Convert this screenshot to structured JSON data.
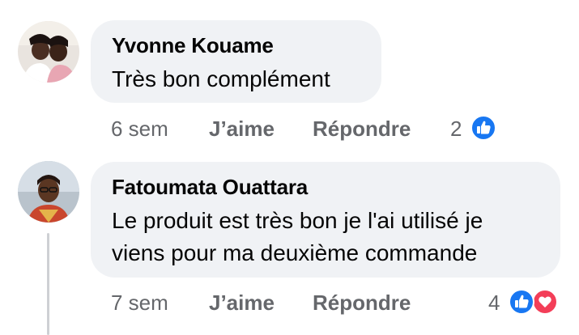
{
  "comments": [
    {
      "author": "Yvonne Kouame",
      "text": "Très bon complément",
      "time": "6 sem",
      "like_label": "J’aime",
      "reply_label": "Répondre",
      "reaction_count": "2",
      "reactions": [
        "like-icon"
      ]
    },
    {
      "author": "Fatoumata Ouattara",
      "text_lines": [
        "Le produit est très bon je l'ai utilisé je",
        "viens pour ma deuxième commande"
      ],
      "time": "7 sem",
      "like_label": "J’aime",
      "reply_label": "Répondre",
      "reaction_count": "4",
      "reactions": [
        "like-icon",
        "love-icon"
      ]
    }
  ],
  "colors": {
    "bubble": "#f0f2f5",
    "meta_text": "#65676b",
    "like_blue": "#1877f2",
    "love_red": "#f33e58"
  }
}
